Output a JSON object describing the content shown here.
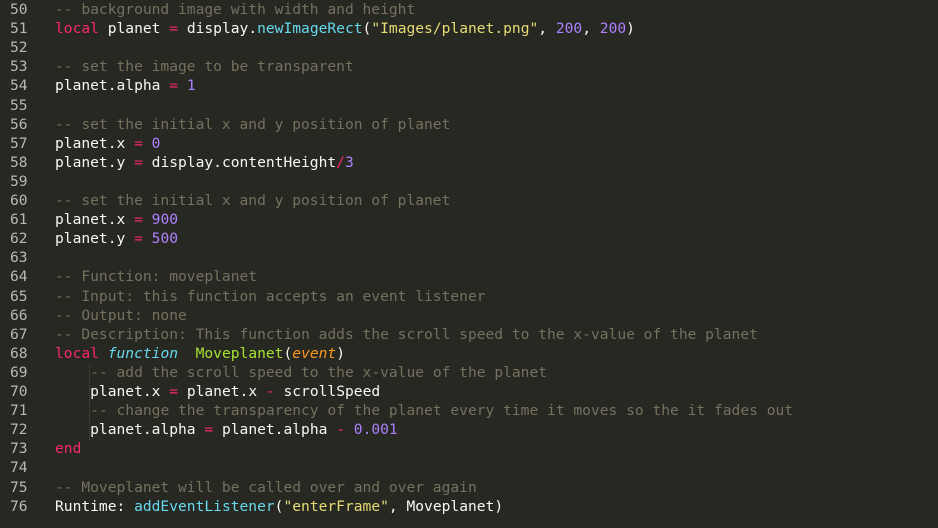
{
  "editor": {
    "theme": "monokai",
    "colors": {
      "background": "#272822",
      "gutter_text": "#b9b9b3",
      "keyword": "#f92672",
      "builtin": "#66d9ef",
      "string": "#e6db74",
      "number": "#ae81ff",
      "comment": "#75715e",
      "function_name": "#a6e22e",
      "parameter": "#fd971f",
      "plain": "#f8f8f2"
    },
    "lines": [
      {
        "n": "50",
        "tokens": [
          {
            "t": "-- background image with width and height",
            "c": "com"
          }
        ]
      },
      {
        "n": "51",
        "tokens": [
          {
            "t": "local",
            "c": "kw"
          },
          {
            "t": " planet ",
            "c": "plain"
          },
          {
            "t": "=",
            "c": "op"
          },
          {
            "t": " display.",
            "c": "plain"
          },
          {
            "t": "newImageRect",
            "c": "fn"
          },
          {
            "t": "(",
            "c": "plain"
          },
          {
            "t": "\"Images/planet.png\"",
            "c": "str"
          },
          {
            "t": ", ",
            "c": "plain"
          },
          {
            "t": "200",
            "c": "num"
          },
          {
            "t": ", ",
            "c": "plain"
          },
          {
            "t": "200",
            "c": "num"
          },
          {
            "t": ")",
            "c": "plain"
          }
        ]
      },
      {
        "n": "52",
        "tokens": []
      },
      {
        "n": "53",
        "tokens": [
          {
            "t": "-- set the image to be transparent",
            "c": "com"
          }
        ]
      },
      {
        "n": "54",
        "tokens": [
          {
            "t": "planet.alpha ",
            "c": "plain"
          },
          {
            "t": "=",
            "c": "op"
          },
          {
            "t": " ",
            "c": "plain"
          },
          {
            "t": "1",
            "c": "num"
          }
        ]
      },
      {
        "n": "55",
        "tokens": []
      },
      {
        "n": "56",
        "tokens": [
          {
            "t": "-- set the initial x and y position of planet",
            "c": "com"
          }
        ]
      },
      {
        "n": "57",
        "tokens": [
          {
            "t": "planet.x ",
            "c": "plain"
          },
          {
            "t": "=",
            "c": "op"
          },
          {
            "t": " ",
            "c": "plain"
          },
          {
            "t": "0",
            "c": "num"
          }
        ]
      },
      {
        "n": "58",
        "tokens": [
          {
            "t": "planet.y ",
            "c": "plain"
          },
          {
            "t": "=",
            "c": "op"
          },
          {
            "t": " display.contentHeight",
            "c": "plain"
          },
          {
            "t": "/",
            "c": "op"
          },
          {
            "t": "3",
            "c": "num"
          }
        ]
      },
      {
        "n": "59",
        "tokens": []
      },
      {
        "n": "60",
        "tokens": [
          {
            "t": "-- set the initial x and y position of planet",
            "c": "com"
          }
        ]
      },
      {
        "n": "61",
        "tokens": [
          {
            "t": "planet.x ",
            "c": "plain"
          },
          {
            "t": "=",
            "c": "op"
          },
          {
            "t": " ",
            "c": "plain"
          },
          {
            "t": "900",
            "c": "num"
          }
        ]
      },
      {
        "n": "62",
        "tokens": [
          {
            "t": "planet.y ",
            "c": "plain"
          },
          {
            "t": "=",
            "c": "op"
          },
          {
            "t": " ",
            "c": "plain"
          },
          {
            "t": "500",
            "c": "num"
          }
        ]
      },
      {
        "n": "63",
        "tokens": []
      },
      {
        "n": "64",
        "tokens": [
          {
            "t": "-- Function: moveplanet",
            "c": "com"
          }
        ]
      },
      {
        "n": "65",
        "tokens": [
          {
            "t": "-- Input: this function accepts an event listener",
            "c": "com"
          }
        ]
      },
      {
        "n": "66",
        "tokens": [
          {
            "t": "-- Output: none",
            "c": "com"
          }
        ]
      },
      {
        "n": "67",
        "tokens": [
          {
            "t": "-- Description: This function adds the scroll speed to the x-value of the planet",
            "c": "com"
          }
        ]
      },
      {
        "n": "68",
        "tokens": [
          {
            "t": "local",
            "c": "kw"
          },
          {
            "t": " ",
            "c": "plain"
          },
          {
            "t": "function",
            "c": "fnkw"
          },
          {
            "t": "  ",
            "c": "plain"
          },
          {
            "t": "Moveplanet",
            "c": "name"
          },
          {
            "t": "(",
            "c": "plain"
          },
          {
            "t": "event",
            "c": "param"
          },
          {
            "t": ")",
            "c": "plain"
          }
        ]
      },
      {
        "n": "69",
        "tokens": [
          {
            "t": "    ",
            "c": "plain"
          },
          {
            "t": "-- add the scroll speed to the x-value of the planet",
            "c": "com"
          }
        ]
      },
      {
        "n": "70",
        "tokens": [
          {
            "t": "    planet.x ",
            "c": "plain"
          },
          {
            "t": "=",
            "c": "op"
          },
          {
            "t": " planet.x ",
            "c": "plain"
          },
          {
            "t": "-",
            "c": "op"
          },
          {
            "t": " scrollSpeed",
            "c": "plain"
          }
        ]
      },
      {
        "n": "71",
        "tokens": [
          {
            "t": "    ",
            "c": "plain"
          },
          {
            "t": "-- change the transparency of the planet every time it moves so the it fades out",
            "c": "com"
          }
        ]
      },
      {
        "n": "72",
        "tokens": [
          {
            "t": "    planet.alpha ",
            "c": "plain"
          },
          {
            "t": "=",
            "c": "op"
          },
          {
            "t": " planet.alpha ",
            "c": "plain"
          },
          {
            "t": "-",
            "c": "op"
          },
          {
            "t": " ",
            "c": "plain"
          },
          {
            "t": "0.001",
            "c": "num"
          }
        ]
      },
      {
        "n": "73",
        "tokens": [
          {
            "t": "end",
            "c": "kw"
          }
        ]
      },
      {
        "n": "74",
        "tokens": []
      },
      {
        "n": "75",
        "tokens": [
          {
            "t": "-- Moveplanet will be called over and over again",
            "c": "com"
          }
        ]
      },
      {
        "n": "76",
        "tokens": [
          {
            "t": "Runtime: ",
            "c": "plain"
          },
          {
            "t": "addEventListener",
            "c": "fn"
          },
          {
            "t": "(",
            "c": "plain"
          },
          {
            "t": "\"enterFrame\"",
            "c": "str"
          },
          {
            "t": ", Moveplanet)",
            "c": "plain"
          }
        ]
      }
    ]
  }
}
